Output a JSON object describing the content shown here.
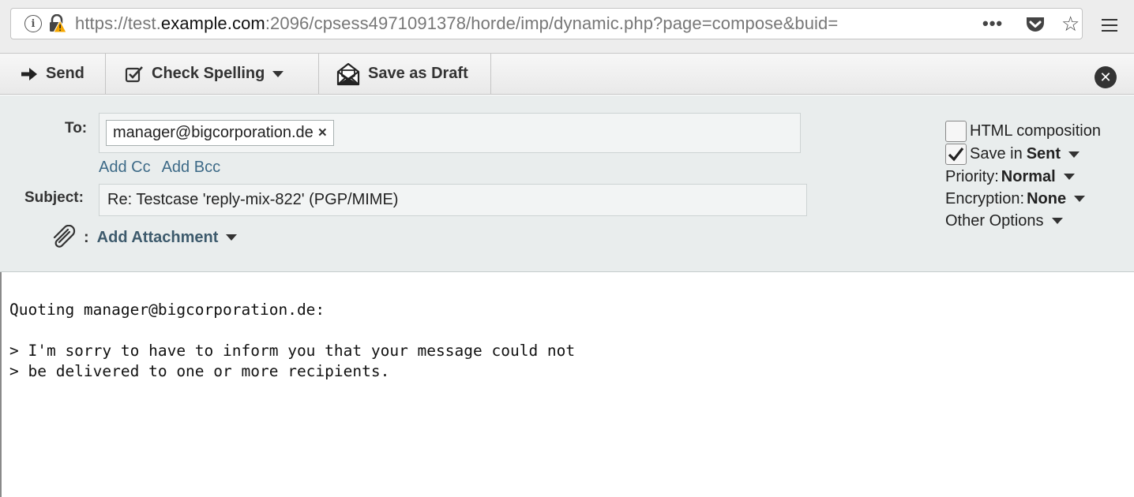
{
  "browser": {
    "url_prefix": "https://test.",
    "url_host": "example.com",
    "url_rest": ":2096/cpsess4971091378/horde/imp/dynamic.php?page=compose&buid=",
    "icons": [
      "info-icon",
      "insecure-lock-icon",
      "more-icon",
      "pocket-icon",
      "star-icon",
      "menu-icon"
    ]
  },
  "toolbar": {
    "send_label": "Send",
    "spell_label": "Check Spelling",
    "draft_label": "Save as Draft"
  },
  "compose": {
    "to_label": "To:",
    "recipient": "manager@bigcorporation.de",
    "add_cc": "Add Cc",
    "add_bcc": "Add Bcc",
    "subject_label": "Subject:",
    "subject_value": "Re: Testcase 'reply-mix-822' (PGP/MIME)",
    "attach_colon": ":",
    "attach_label": "Add Attachment"
  },
  "options": {
    "html_label": "HTML composition",
    "html_checked": false,
    "save_prefix": "Save in",
    "save_value": "Sent",
    "save_checked": true,
    "priority_label": "Priority:",
    "priority_value": "Normal",
    "encryption_label": "Encryption:",
    "encryption_value": "None",
    "other_label": "Other Options"
  },
  "body": {
    "line1": "Quoting manager@bigcorporation.de:",
    "line2": "",
    "line3": "> I'm sorry to have to inform you that your message could not",
    "line4": "> be delivered to one or more recipients."
  },
  "colors": {
    "link": "#3d6a87",
    "header_bg": "#e9eded",
    "lock_warning": "#e8a000"
  }
}
